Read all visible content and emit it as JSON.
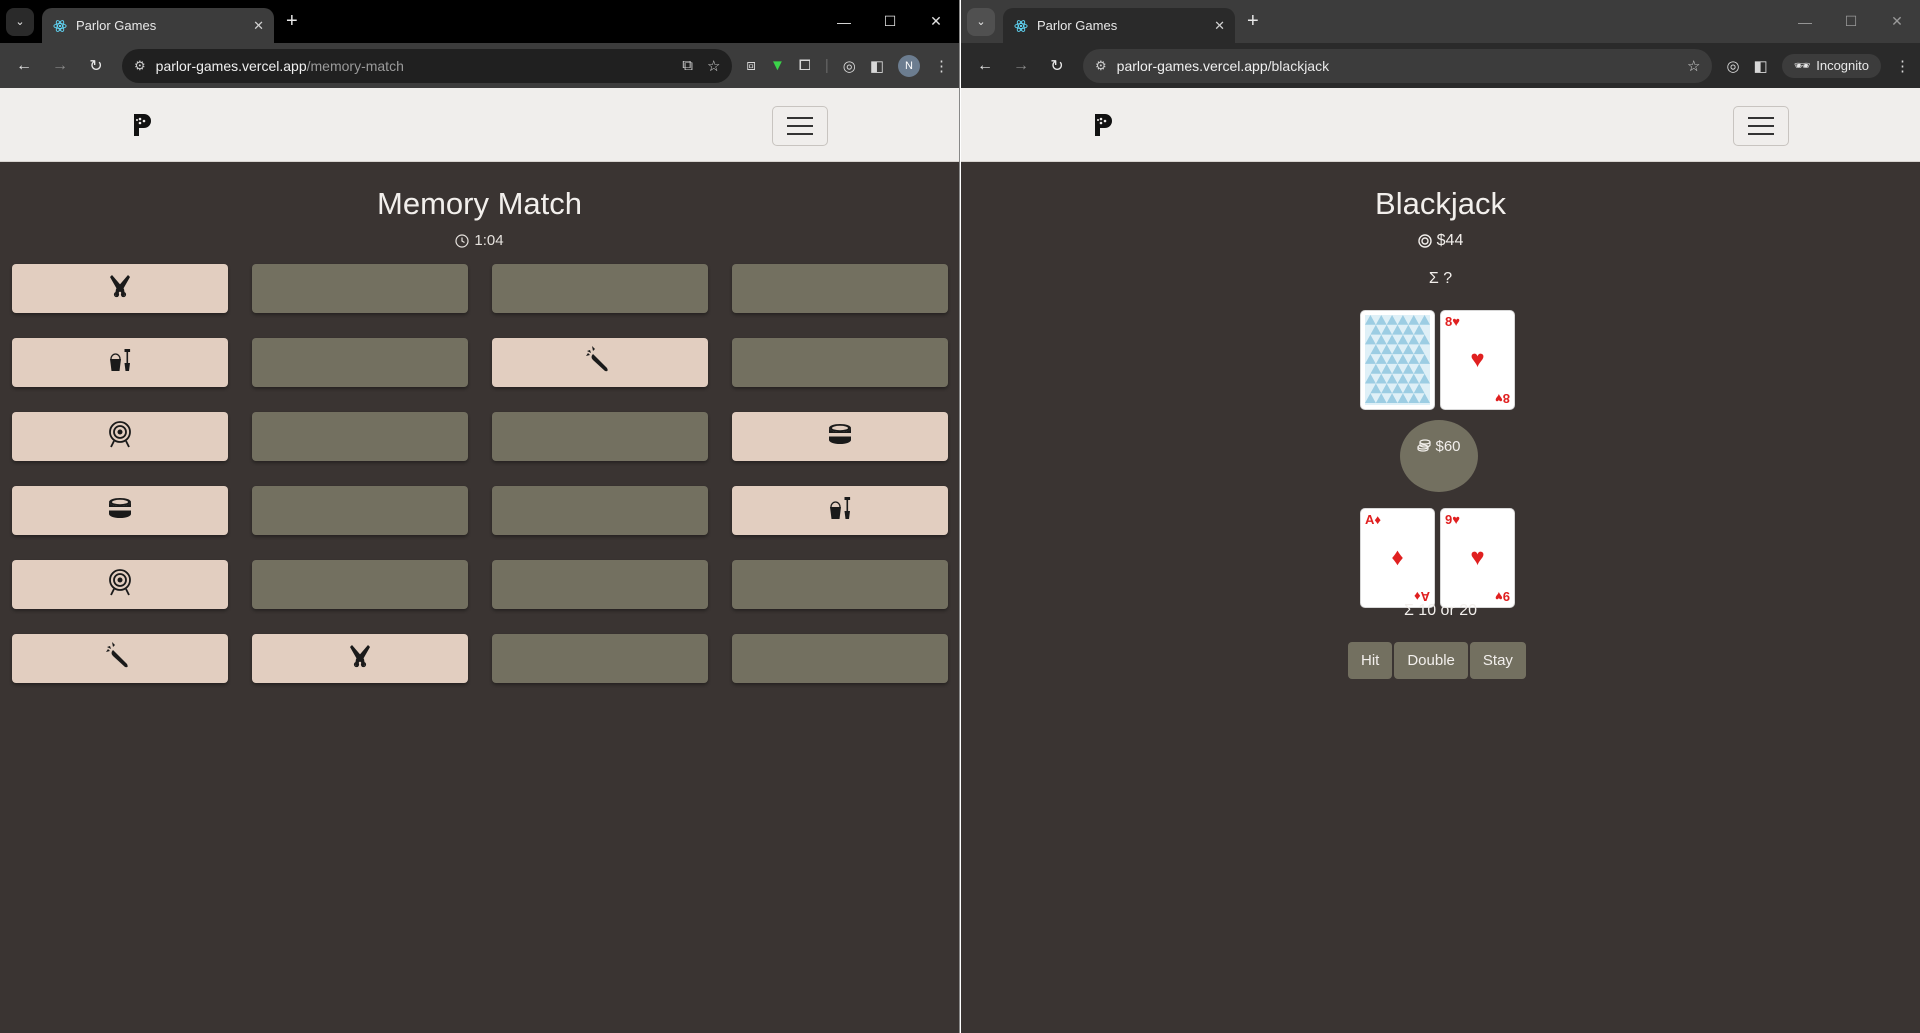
{
  "left_window": {
    "tab": {
      "title": "Parlor Games"
    },
    "url": {
      "host": "parlor-games.vercel.app",
      "path": "/memory-match"
    },
    "game": {
      "title": "Memory Match",
      "timer": "1:04",
      "tiles": [
        {
          "state": "face-up",
          "icon": "crossed-pistols-icon"
        },
        {
          "state": "face-down",
          "icon": ""
        },
        {
          "state": "face-down",
          "icon": ""
        },
        {
          "state": "face-down",
          "icon": ""
        },
        {
          "state": "face-up",
          "icon": "bucket-shovel-icon"
        },
        {
          "state": "face-down",
          "icon": ""
        },
        {
          "state": "face-up",
          "icon": "carrot-icon"
        },
        {
          "state": "face-down",
          "icon": ""
        },
        {
          "state": "face-up",
          "icon": "archery-target-icon"
        },
        {
          "state": "face-down",
          "icon": ""
        },
        {
          "state": "face-down",
          "icon": ""
        },
        {
          "state": "face-up",
          "icon": "tin-can-icon"
        },
        {
          "state": "face-up",
          "icon": "tin-can-icon"
        },
        {
          "state": "face-down",
          "icon": ""
        },
        {
          "state": "face-down",
          "icon": ""
        },
        {
          "state": "face-up",
          "icon": "bucket-shovel-icon"
        },
        {
          "state": "face-up",
          "icon": "archery-target-icon"
        },
        {
          "state": "face-down",
          "icon": ""
        },
        {
          "state": "face-down",
          "icon": ""
        },
        {
          "state": "face-down",
          "icon": ""
        },
        {
          "state": "face-up",
          "icon": "carrot-icon"
        },
        {
          "state": "face-up",
          "icon": "crossed-pistols-icon"
        },
        {
          "state": "face-down",
          "icon": ""
        },
        {
          "state": "face-down",
          "icon": ""
        }
      ]
    },
    "avatar_letter": "N"
  },
  "right_window": {
    "tab": {
      "title": "Parlor Games"
    },
    "url": {
      "host": "parlor-games.vercel.app",
      "path": "/blackjack"
    },
    "incognito_label": "Incognito",
    "game": {
      "title": "Blackjack",
      "bank": "$44",
      "dealer_sum": "Σ ?",
      "dealer_cards": [
        {
          "face_down": true
        },
        {
          "rank": "8",
          "suit": "♥"
        }
      ],
      "bet": "$60",
      "player_cards": [
        {
          "rank": "A",
          "suit": "♦"
        },
        {
          "rank": "9",
          "suit": "♥"
        }
      ],
      "player_sum": "Σ 10 or 20",
      "actions": {
        "hit": "Hit",
        "double": "Double",
        "stay": "Stay"
      }
    }
  },
  "colors": {
    "page_bg": "#3a3432",
    "tile_face_up": "#e2cec0",
    "tile_face_down": "#737060",
    "card_red": "#e02020"
  }
}
